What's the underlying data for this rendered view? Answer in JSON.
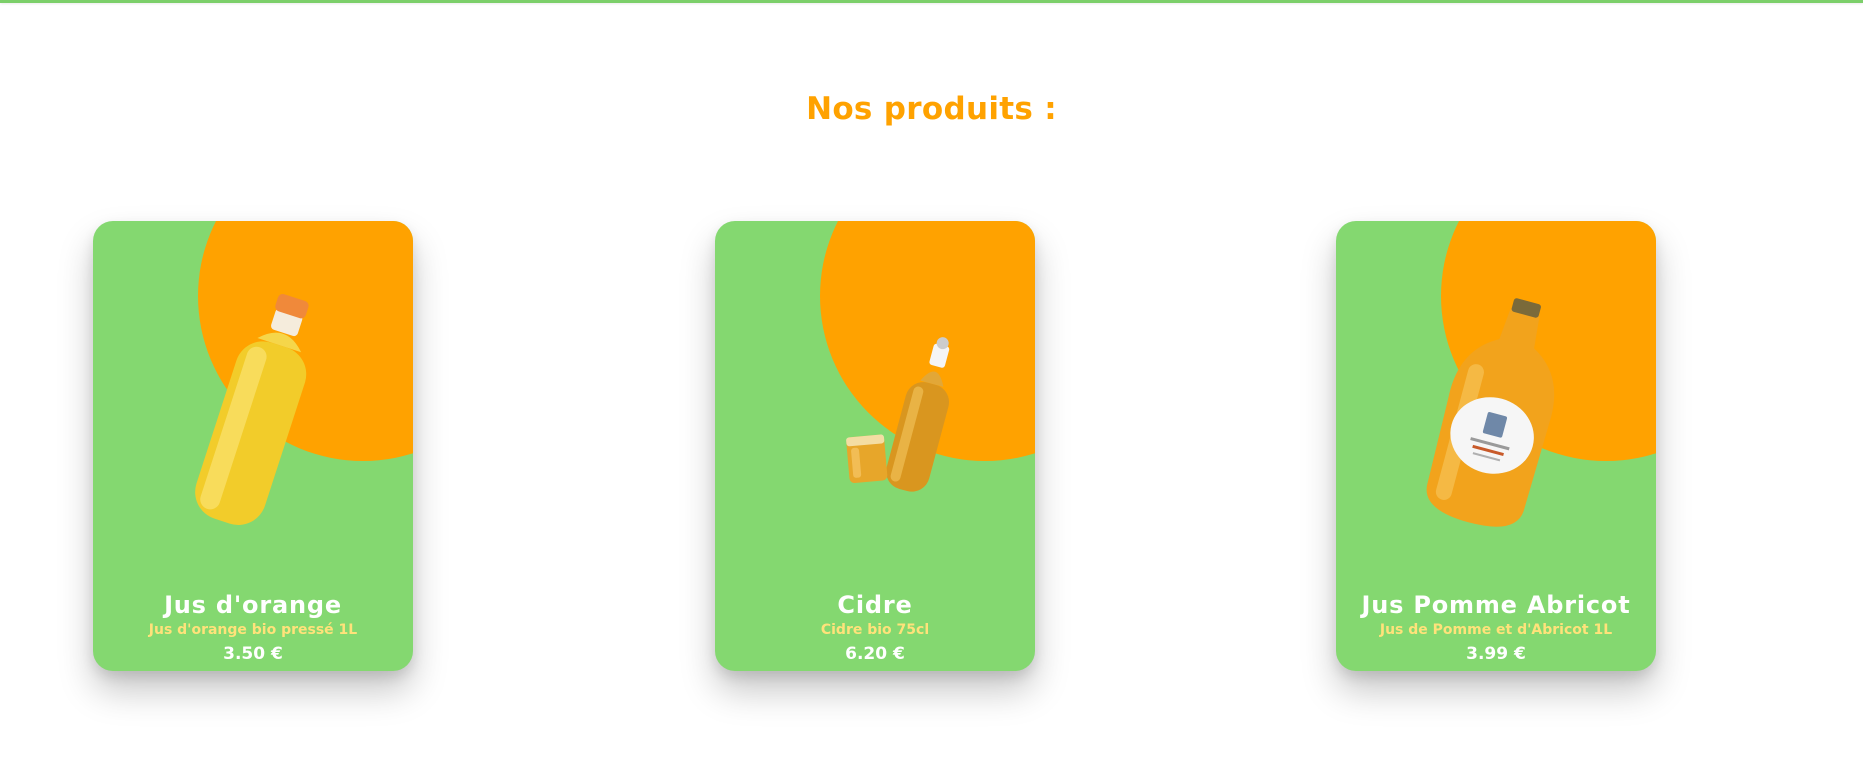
{
  "section": {
    "title": "Nos produits :"
  },
  "products": [
    {
      "name": "Jus d'orange",
      "description": "Jus d'orange bio pressé 1L",
      "price": "3.50 €",
      "image_icon": "orange-juice-bottle-icon"
    },
    {
      "name": "Cidre",
      "description": "Cidre bio 75cl",
      "price": "6.20 €",
      "image_icon": "cider-bottle-and-glass-icon"
    },
    {
      "name": "Jus Pomme Abricot",
      "description": "Jus de Pomme et d'Abricot 1L",
      "price": "3.99 €",
      "image_icon": "apple-apricot-juice-bottle-icon"
    }
  ],
  "colors": {
    "card_green": "#84d870",
    "accent_orange": "#ffa200",
    "description_yellow": "#ffe27a",
    "top_line_green": "#7ccf6a"
  }
}
